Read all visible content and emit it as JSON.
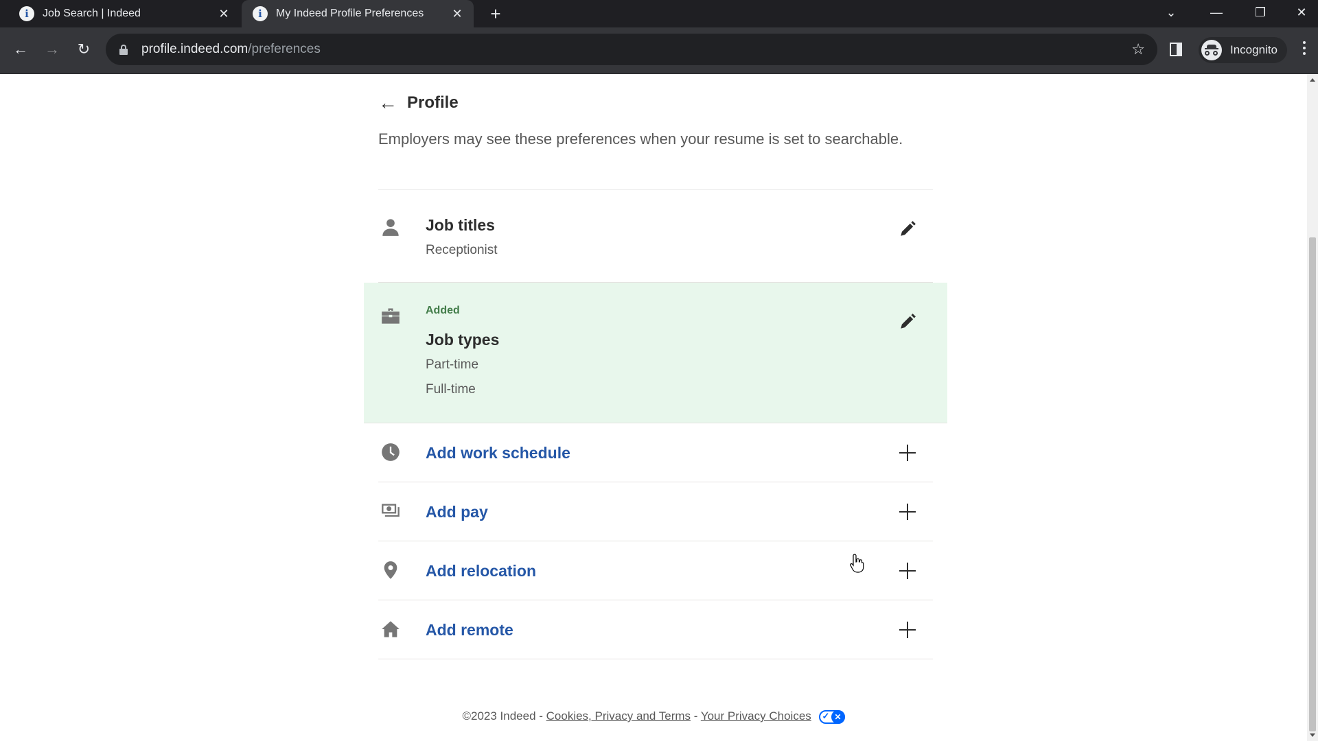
{
  "browser": {
    "tabs": [
      {
        "title": "Job Search | Indeed",
        "active": false,
        "favicon": "indeed-info-icon"
      },
      {
        "title": "My Indeed Profile Preferences",
        "active": true,
        "favicon": "indeed-info-icon"
      }
    ],
    "tab_close_glyph": "✕",
    "new_tab_glyph": "+",
    "favicon_glyph": "i",
    "window_controls": {
      "tab_search": "⌄",
      "minimize": "—",
      "restore": "❐",
      "close": "✕"
    },
    "nav": {
      "back": "←",
      "forward": "→",
      "reload": "↻"
    },
    "url": {
      "host": "profile.indeed.com",
      "path": "/preferences"
    },
    "bookmark_glyph": "☆",
    "profile_label": "Incognito"
  },
  "page": {
    "back_label": "Profile",
    "back_arrow": "←",
    "intro": "Employers may see these preferences when your resume is set to searchable.",
    "sections": {
      "job_titles": {
        "title": "Job titles",
        "values": [
          "Receptionist"
        ],
        "icon": "person-icon"
      },
      "job_types": {
        "badge": "Added",
        "title": "Job types",
        "values": [
          "Part-time",
          "Full-time"
        ],
        "icon": "briefcase-icon"
      }
    },
    "add_rows": [
      {
        "label": "Add work schedule",
        "icon": "clock-icon"
      },
      {
        "label": "Add pay",
        "icon": "money-icon"
      },
      {
        "label": "Add relocation",
        "icon": "location-pin-icon"
      },
      {
        "label": "Add remote",
        "icon": "home-icon"
      }
    ],
    "footer": {
      "copyright": "©2023 Indeed - ",
      "link1": "Cookies, Privacy and Terms",
      "separator": " - ",
      "link2": "Your Privacy Choices"
    }
  },
  "colors": {
    "link_blue": "#2557a7",
    "added_green": "#437d4a",
    "highlight_bg": "#e8f7ec"
  }
}
